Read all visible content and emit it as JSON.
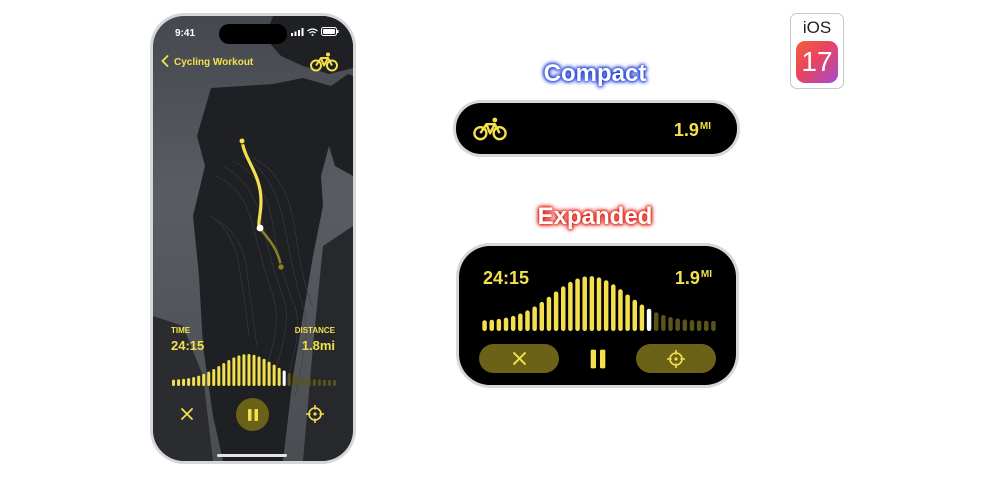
{
  "phone": {
    "status_time": "9:41",
    "nav": {
      "title": "Cycling Workout",
      "back_icon": "chevron-left-icon",
      "activity_icon": "bicycle-icon"
    },
    "stats": {
      "time_label": "TIME",
      "time_value": "24:15",
      "distance_label": "DISTANCE",
      "distance_value": "1.8mi"
    },
    "progress": {
      "bar_count": 33,
      "completed": 23,
      "current_index": 22
    },
    "controls": {
      "close_icon": "close-icon",
      "pause_icon": "pause-icon",
      "locate_icon": "crosshair-icon"
    }
  },
  "compact": {
    "heading": "Compact",
    "icon": "bicycle-icon",
    "distance_value": "1.9",
    "distance_unit": "MI"
  },
  "expanded": {
    "heading": "Expanded",
    "time_value": "24:15",
    "distance_value": "1.9",
    "distance_unit": "MI",
    "progress": {
      "bar_count": 33,
      "completed": 24,
      "current_index": 23
    },
    "buttons": {
      "close_icon": "close-icon",
      "pause_icon": "pause-icon",
      "locate_icon": "crosshair-icon"
    }
  },
  "badge": {
    "os": "iOS",
    "version": "17"
  },
  "colors": {
    "accent": "#f4e04d",
    "dim_bar": "#59531c",
    "button_fill": "#6b6217",
    "compact_glow": "#2945d9",
    "expanded_glow": "#e02a1c"
  }
}
